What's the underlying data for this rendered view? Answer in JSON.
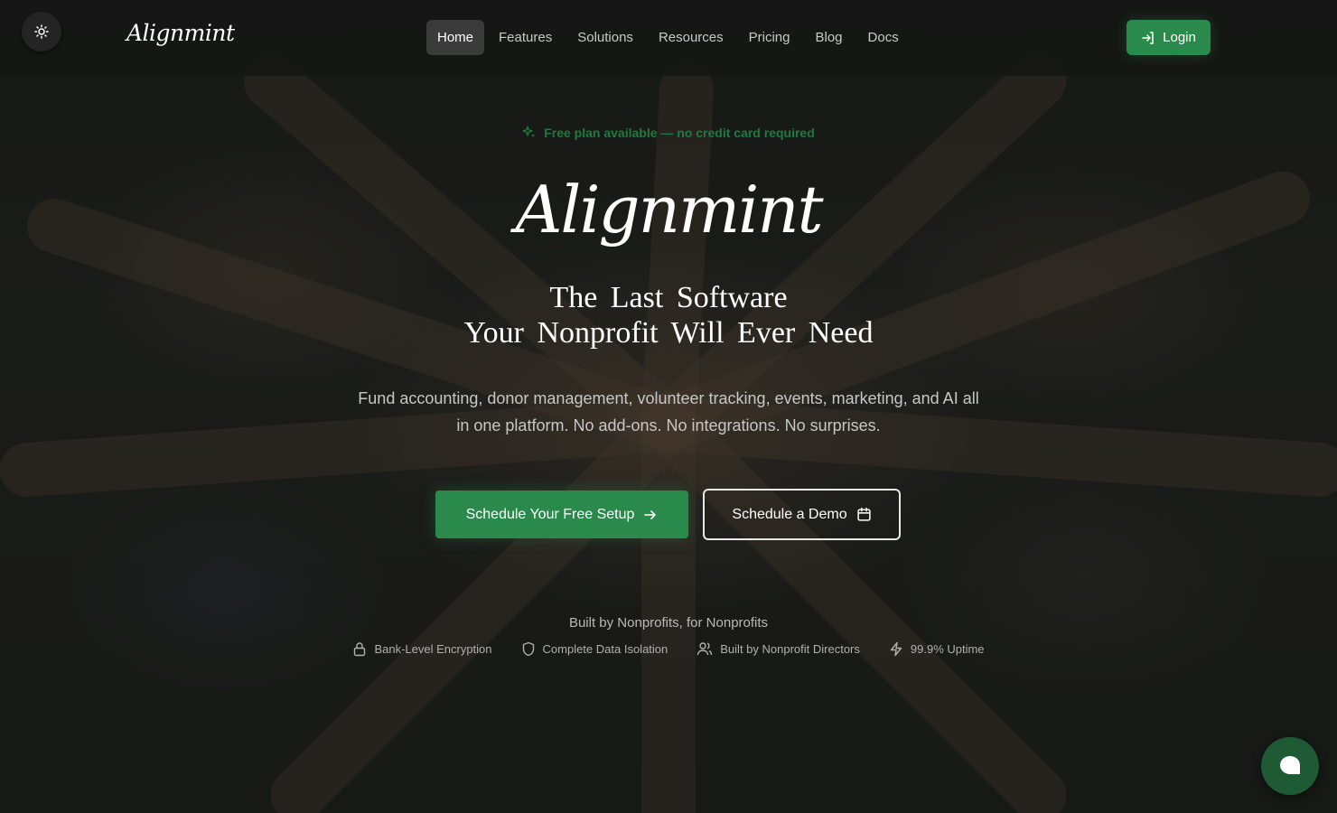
{
  "header": {
    "logo": "Alignmint",
    "nav": [
      "Home",
      "Features",
      "Solutions",
      "Resources",
      "Pricing",
      "Blog",
      "Docs"
    ],
    "active_nav": "Home",
    "login_label": "Login"
  },
  "hero": {
    "badge": "Free plan available — no credit card required",
    "logo": "Alignmint",
    "headline_line1": "The Last Software",
    "headline_line2": "Your Nonprofit Will Ever Need",
    "subtitle": "Fund accounting, donor management, volunteer tracking, events, marketing, and AI all in one platform. No add-ons. No integrations. No surprises.",
    "cta_primary": "Schedule Your Free Setup",
    "cta_secondary": "Schedule a Demo"
  },
  "trust": {
    "heading": "Built by Nonprofits, for Nonprofits",
    "items": [
      {
        "label": "Bank-Level Encryption",
        "icon": "lock-icon"
      },
      {
        "label": "Complete Data Isolation",
        "icon": "shield-icon"
      },
      {
        "label": "Built by Nonprofit Directors",
        "icon": "users-icon"
      },
      {
        "label": "99.9% Uptime",
        "icon": "zap-icon"
      }
    ]
  },
  "colors": {
    "accent": "#2a8a4c",
    "chat": "#1e5a34",
    "badge_text": "#1f7a40"
  }
}
